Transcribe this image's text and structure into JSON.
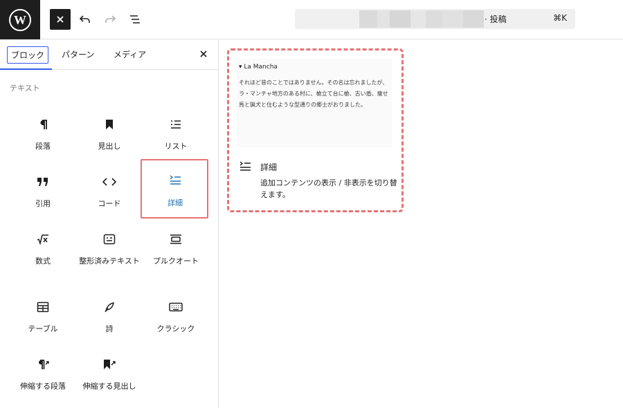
{
  "topbar": {
    "logo_icon": "wordpress-logo-icon",
    "toggle_icon": "close-icon",
    "undo_icon": "undo-icon",
    "redo_icon": "redo-icon",
    "outline_icon": "document-overview-icon",
    "command": {
      "title": "· 投稿",
      "shortcut": "⌘K"
    }
  },
  "inserter": {
    "tabs": [
      {
        "label": "ブロック",
        "active": true
      },
      {
        "label": "パターン",
        "active": false
      },
      {
        "label": "メディア",
        "active": false
      }
    ],
    "close_icon": "close-icon",
    "category": "テキスト",
    "blocks": [
      {
        "label": "段落",
        "icon": "paragraph-icon"
      },
      {
        "label": "見出し",
        "icon": "heading-bookmark-icon"
      },
      {
        "label": "リスト",
        "icon": "list-icon"
      },
      {
        "label": "引用",
        "icon": "quote-icon"
      },
      {
        "label": "コード",
        "icon": "code-icon"
      },
      {
        "label": "詳細",
        "icon": "details-icon",
        "selected": true
      },
      {
        "label": "数式",
        "icon": "math-icon"
      },
      {
        "label": "整形済みテキスト",
        "icon": "preformatted-icon"
      },
      {
        "label": "プルクオート",
        "icon": "pullquote-icon"
      },
      {
        "label": "テーブル",
        "icon": "table-icon"
      },
      {
        "label": "詩",
        "icon": "verse-icon"
      },
      {
        "label": "クラシック",
        "icon": "keyboard-icon"
      },
      {
        "label": "伸縮する段落",
        "icon": "stretchy-paragraph-icon"
      },
      {
        "label": "伸縮する見出し",
        "icon": "stretchy-heading-icon"
      }
    ]
  },
  "preview": {
    "summary": "▾ La Mancha",
    "content": "それほど昔のことではありません。その名は忘れましたが、ラ・マンチャ地方のある村に、槍立て台に槍、古い盾、痩せ馬と猟犬と住むような型通りの郷士がおりました。",
    "block_title": "詳細",
    "block_description": "追加コンテンツの表示 / 非表示を切り替えます。",
    "icon": "details-icon"
  },
  "colors": {
    "accent": "#3858e9",
    "highlight": "#e57373",
    "dark": "#1e1e1e"
  }
}
